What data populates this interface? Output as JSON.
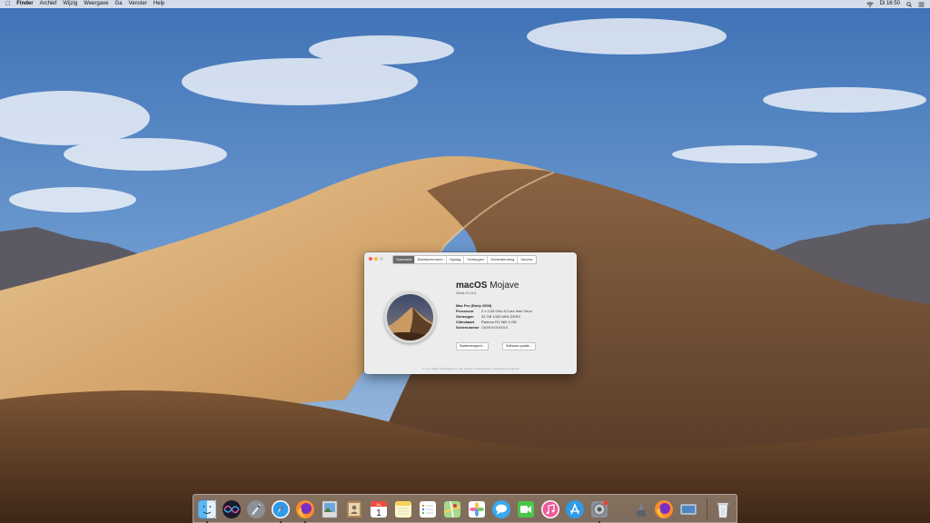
{
  "menubar": {
    "app": "Finder",
    "items": [
      "Archief",
      "Wijzig",
      "Weergave",
      "Ga",
      "Venster",
      "Help"
    ],
    "clock": "Di 16:50"
  },
  "about_window": {
    "tabs": [
      {
        "label": "Overzicht",
        "active": true
      },
      {
        "label": "Beeldschermen",
        "active": false
      },
      {
        "label": "Opslag",
        "active": false
      },
      {
        "label": "Geheugen",
        "active": false
      },
      {
        "label": "Ondersteuning",
        "active": false
      },
      {
        "label": "Service",
        "active": false
      }
    ],
    "os_name": "macOS",
    "os_codename": "Mojave",
    "version": "Versie 10.14.6",
    "model": "Mac Pro (Early 2009)",
    "specs": [
      {
        "label": "Processor",
        "value": "2 x 2,93 GHz 6-Core Intel Xeon"
      },
      {
        "label": "Geheugen",
        "value": "32 GB 1333 MHz DDR3"
      },
      {
        "label": "Videokaart",
        "value": "Radeon RX 560 4 GB"
      },
      {
        "label": "Serienummer",
        "value": "CK9XXXXXXXX"
      }
    ],
    "buttons": {
      "report": "Systeemrapport…",
      "update": "Software-update…"
    },
    "copyright": "™ en © 1983–2019 Apple Inc. Alle rechten voorbehouden. Licentieovereenkomst"
  },
  "colors": {
    "close": "#fc5f57",
    "minimize": "#fdbc2e",
    "active_tab": "#6a6a6a"
  },
  "dock": {
    "apps": [
      {
        "name": "Finder",
        "icon": "finder-icon",
        "running": true
      },
      {
        "name": "Siri",
        "icon": "siri-icon",
        "running": false
      },
      {
        "name": "Launchpad",
        "icon": "launchpad-icon",
        "running": false
      },
      {
        "name": "Safari",
        "icon": "safari-icon",
        "running": true
      },
      {
        "name": "Firefox",
        "icon": "firefox-icon",
        "running": true
      },
      {
        "name": "Preview",
        "icon": "preview-icon",
        "running": false
      },
      {
        "name": "Contacts",
        "icon": "contacts-icon",
        "running": false
      },
      {
        "name": "Calendar",
        "icon": "calendar-icon",
        "running": false
      },
      {
        "name": "Notes",
        "icon": "notes-icon",
        "running": false
      },
      {
        "name": "Reminders",
        "icon": "reminders-icon",
        "running": false
      },
      {
        "name": "Maps",
        "icon": "maps-icon",
        "running": false
      },
      {
        "name": "Photos",
        "icon": "photos-icon",
        "running": false
      },
      {
        "name": "Messages",
        "icon": "messages-icon",
        "running": false
      },
      {
        "name": "FaceTime",
        "icon": "facetime-icon",
        "running": false
      },
      {
        "name": "iTunes",
        "icon": "itunes-icon",
        "running": false
      },
      {
        "name": "App Store",
        "icon": "app-store-icon",
        "running": false
      },
      {
        "name": "System Preferences",
        "icon": "system-preferences-icon",
        "running": true
      },
      {
        "name": "Script Editor",
        "icon": "script-editor-icon",
        "running": false
      },
      {
        "name": "Firefox",
        "icon": "firefox-icon",
        "running": false
      },
      {
        "name": "Image Capture",
        "icon": "image-capture-icon",
        "running": false
      },
      {
        "name": "Trash",
        "icon": "trash-icon",
        "running": false
      }
    ],
    "calendar_day": "1",
    "calendar_month": "JUL"
  }
}
